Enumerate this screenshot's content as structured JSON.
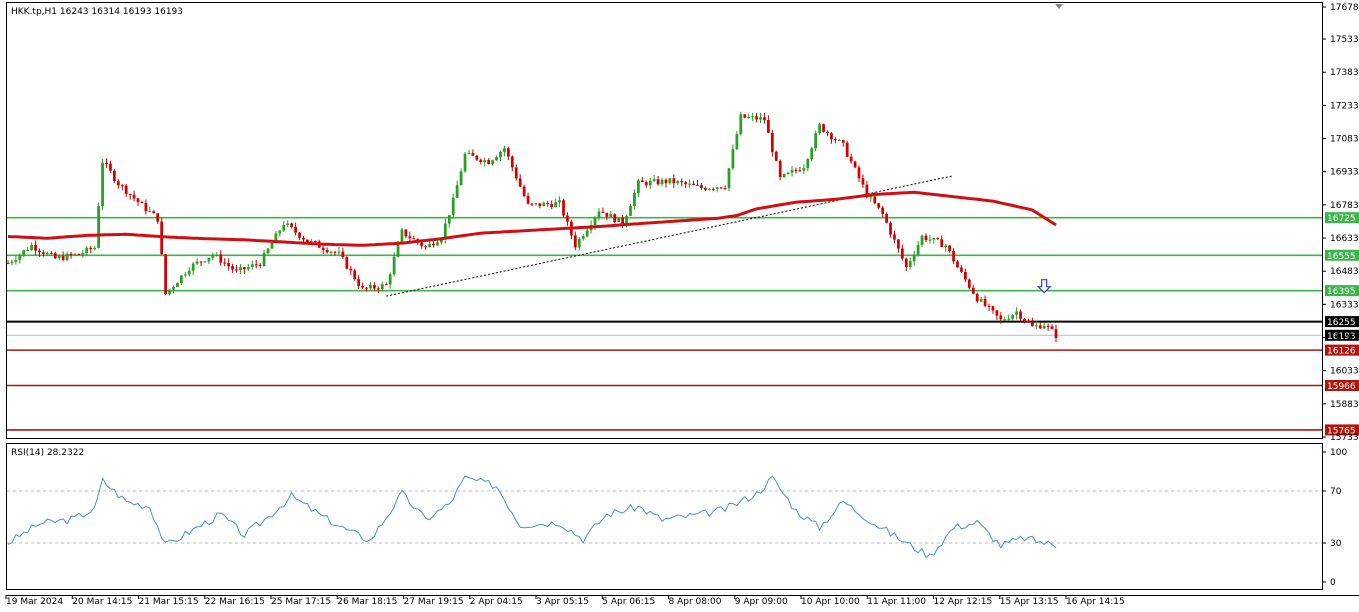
{
  "chart_data": [
    {
      "type": "candlestick",
      "title": "HKK.tp,H1  16243 16314 16193 16193",
      "ylim": [
        15733,
        17678
      ],
      "yticks": [
        17678,
        17533,
        17383,
        17233,
        17083,
        16933,
        16783,
        16633,
        16483,
        16333,
        16183,
        16033,
        15883,
        15733
      ],
      "xticks": [
        "19 Mar 2024",
        "20 Mar 14:15",
        "21 Mar 15:15",
        "22 Mar 16:15",
        "25 Mar 17:15",
        "26 Mar 18:15",
        "27 Mar 19:15",
        "2 Apr 04:15",
        "3 Apr 05:15",
        "5 Apr 06:15",
        "8 Apr 08:00",
        "9 Apr 09:00",
        "10 Apr 10:00",
        "11 Apr 11:00",
        "12 Apr 12:15",
        "15 Apr 13:15",
        "16 Apr 14:15"
      ],
      "colors": {
        "up": "#26a021",
        "down": "#d40000",
        "ma": "#d10f12",
        "support": "#3cb44b",
        "resistance": "#b0140f",
        "current": "#000000",
        "trend": "#000000",
        "arrow": "#3a3ad0"
      },
      "levels": [
        {
          "value": 16725,
          "label": "16725",
          "kind": "support"
        },
        {
          "value": 16555,
          "label": "16555",
          "kind": "support"
        },
        {
          "value": 16395,
          "label": "16395",
          "kind": "support"
        },
        {
          "value": 16255,
          "label": "16255",
          "kind": "current"
        },
        {
          "value": 16193,
          "label": "16193",
          "kind": "price"
        },
        {
          "value": 16126,
          "label": "16126",
          "kind": "resistance"
        },
        {
          "value": 15966,
          "label": "15966",
          "kind": "resistance"
        },
        {
          "value": 15765,
          "label": "15765",
          "kind": "resistance"
        }
      ],
      "moving_average": [
        {
          "i": 0,
          "y": 16640
        },
        {
          "i": 10,
          "y": 16632
        },
        {
          "i": 20,
          "y": 16645
        },
        {
          "i": 30,
          "y": 16650
        },
        {
          "i": 40,
          "y": 16638
        },
        {
          "i": 50,
          "y": 16630
        },
        {
          "i": 60,
          "y": 16625
        },
        {
          "i": 70,
          "y": 16615
        },
        {
          "i": 80,
          "y": 16605
        },
        {
          "i": 90,
          "y": 16600
        },
        {
          "i": 100,
          "y": 16610
        },
        {
          "i": 110,
          "y": 16630
        },
        {
          "i": 120,
          "y": 16655
        },
        {
          "i": 130,
          "y": 16665
        },
        {
          "i": 140,
          "y": 16675
        },
        {
          "i": 150,
          "y": 16685
        },
        {
          "i": 160,
          "y": 16698
        },
        {
          "i": 170,
          "y": 16710
        },
        {
          "i": 180,
          "y": 16722
        },
        {
          "i": 185,
          "y": 16735
        },
        {
          "i": 190,
          "y": 16765
        },
        {
          "i": 200,
          "y": 16795
        },
        {
          "i": 210,
          "y": 16808
        },
        {
          "i": 220,
          "y": 16830
        },
        {
          "i": 230,
          "y": 16840
        },
        {
          "i": 240,
          "y": 16820
        },
        {
          "i": 250,
          "y": 16800
        },
        {
          "i": 260,
          "y": 16760
        },
        {
          "i": 266,
          "y": 16692
        }
      ],
      "trendline": {
        "from": {
          "i": 96,
          "y": 16370
        },
        "to": {
          "i": 240,
          "y": 16915
        }
      },
      "arrow": {
        "i": 263,
        "y": 16345
      },
      "candles_count": 267,
      "anchors": [
        {
          "i": 0,
          "y": 16520
        },
        {
          "i": 6,
          "y": 16600
        },
        {
          "i": 12,
          "y": 16540
        },
        {
          "i": 18,
          "y": 16560
        },
        {
          "i": 22,
          "y": 16590
        },
        {
          "i": 24,
          "y": 16980
        },
        {
          "i": 28,
          "y": 16880
        },
        {
          "i": 34,
          "y": 16780
        },
        {
          "i": 38,
          "y": 16720
        },
        {
          "i": 40,
          "y": 16380
        },
        {
          "i": 46,
          "y": 16500
        },
        {
          "i": 52,
          "y": 16560
        },
        {
          "i": 58,
          "y": 16480
        },
        {
          "i": 64,
          "y": 16520
        },
        {
          "i": 70,
          "y": 16700
        },
        {
          "i": 76,
          "y": 16620
        },
        {
          "i": 84,
          "y": 16560
        },
        {
          "i": 90,
          "y": 16400
        },
        {
          "i": 96,
          "y": 16420
        },
        {
          "i": 100,
          "y": 16660
        },
        {
          "i": 106,
          "y": 16590
        },
        {
          "i": 110,
          "y": 16640
        },
        {
          "i": 113,
          "y": 16800
        },
        {
          "i": 116,
          "y": 17010
        },
        {
          "i": 122,
          "y": 16980
        },
        {
          "i": 126,
          "y": 17040
        },
        {
          "i": 132,
          "y": 16780
        },
        {
          "i": 140,
          "y": 16790
        },
        {
          "i": 144,
          "y": 16600
        },
        {
          "i": 150,
          "y": 16760
        },
        {
          "i": 156,
          "y": 16700
        },
        {
          "i": 160,
          "y": 16880
        },
        {
          "i": 168,
          "y": 16890
        },
        {
          "i": 176,
          "y": 16860
        },
        {
          "i": 182,
          "y": 16870
        },
        {
          "i": 186,
          "y": 17180
        },
        {
          "i": 192,
          "y": 17170
        },
        {
          "i": 196,
          "y": 16900
        },
        {
          "i": 202,
          "y": 16960
        },
        {
          "i": 206,
          "y": 17140
        },
        {
          "i": 212,
          "y": 17050
        },
        {
          "i": 218,
          "y": 16830
        },
        {
          "i": 222,
          "y": 16740
        },
        {
          "i": 228,
          "y": 16500
        },
        {
          "i": 232,
          "y": 16640
        },
        {
          "i": 238,
          "y": 16600
        },
        {
          "i": 241,
          "y": 16500
        },
        {
          "i": 246,
          "y": 16360
        },
        {
          "i": 252,
          "y": 16260
        },
        {
          "i": 256,
          "y": 16300
        },
        {
          "i": 260,
          "y": 16230
        },
        {
          "i": 263,
          "y": 16243
        },
        {
          "i": 266,
          "y": 16193
        }
      ]
    },
    {
      "type": "line",
      "title": "RSI(14) 28.2322",
      "ylim": [
        0,
        100
      ],
      "yticks": [
        100,
        70,
        30,
        0
      ],
      "levels": [
        70,
        30
      ],
      "color": "#4a8fd6",
      "anchors": [
        {
          "i": 0,
          "y": 30
        },
        {
          "i": 8,
          "y": 45
        },
        {
          "i": 16,
          "y": 48
        },
        {
          "i": 22,
          "y": 56
        },
        {
          "i": 24,
          "y": 78
        },
        {
          "i": 30,
          "y": 62
        },
        {
          "i": 36,
          "y": 58
        },
        {
          "i": 40,
          "y": 28
        },
        {
          "i": 48,
          "y": 42
        },
        {
          "i": 54,
          "y": 52
        },
        {
          "i": 60,
          "y": 36
        },
        {
          "i": 66,
          "y": 50
        },
        {
          "i": 72,
          "y": 66
        },
        {
          "i": 80,
          "y": 50
        },
        {
          "i": 86,
          "y": 40
        },
        {
          "i": 92,
          "y": 32
        },
        {
          "i": 100,
          "y": 68
        },
        {
          "i": 106,
          "y": 48
        },
        {
          "i": 112,
          "y": 60
        },
        {
          "i": 116,
          "y": 80
        },
        {
          "i": 124,
          "y": 74
        },
        {
          "i": 130,
          "y": 44
        },
        {
          "i": 140,
          "y": 46
        },
        {
          "i": 146,
          "y": 33
        },
        {
          "i": 152,
          "y": 52
        },
        {
          "i": 160,
          "y": 58
        },
        {
          "i": 166,
          "y": 48
        },
        {
          "i": 176,
          "y": 52
        },
        {
          "i": 182,
          "y": 56
        },
        {
          "i": 190,
          "y": 68
        },
        {
          "i": 194,
          "y": 80
        },
        {
          "i": 200,
          "y": 55
        },
        {
          "i": 206,
          "y": 42
        },
        {
          "i": 212,
          "y": 62
        },
        {
          "i": 220,
          "y": 45
        },
        {
          "i": 228,
          "y": 30
        },
        {
          "i": 234,
          "y": 20
        },
        {
          "i": 240,
          "y": 42
        },
        {
          "i": 246,
          "y": 46
        },
        {
          "i": 252,
          "y": 28
        },
        {
          "i": 258,
          "y": 34
        },
        {
          "i": 266,
          "y": 28
        }
      ]
    }
  ]
}
